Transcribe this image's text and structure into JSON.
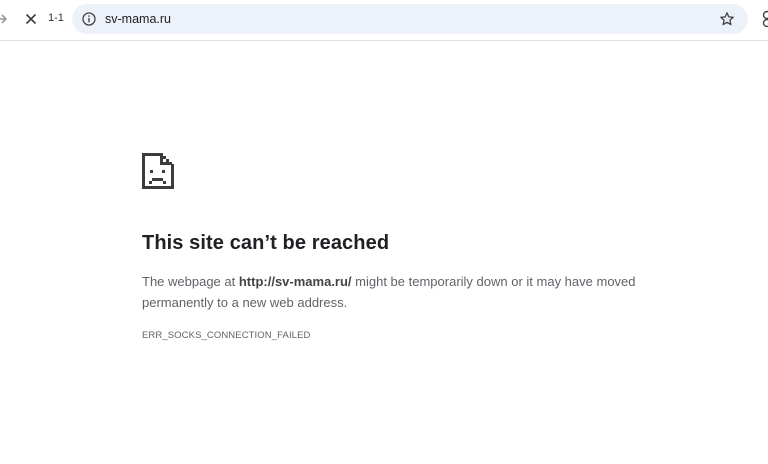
{
  "browser": {
    "tab_counter": "1-1",
    "url": "sv-mama.ru",
    "icons": {
      "forward": "forward-arrow-icon",
      "stop": "close-icon",
      "site_info": "info-icon",
      "bookmark": "star-icon",
      "profile": "profile-icon"
    }
  },
  "error_page": {
    "icon": "sad-page-icon",
    "title": "This site can’t be reached",
    "desc_prefix": "The webpage at ",
    "desc_url": "http://sv-mama.ru/",
    "desc_suffix": " might be temporarily down or it may have moved permanently to a new web address.",
    "error_code": "ERR_SOCKS_CONNECTION_FAILED"
  },
  "colors": {
    "omnibox_bg": "#edf2fa",
    "title_text": "#202124",
    "body_text": "#5f6368"
  }
}
